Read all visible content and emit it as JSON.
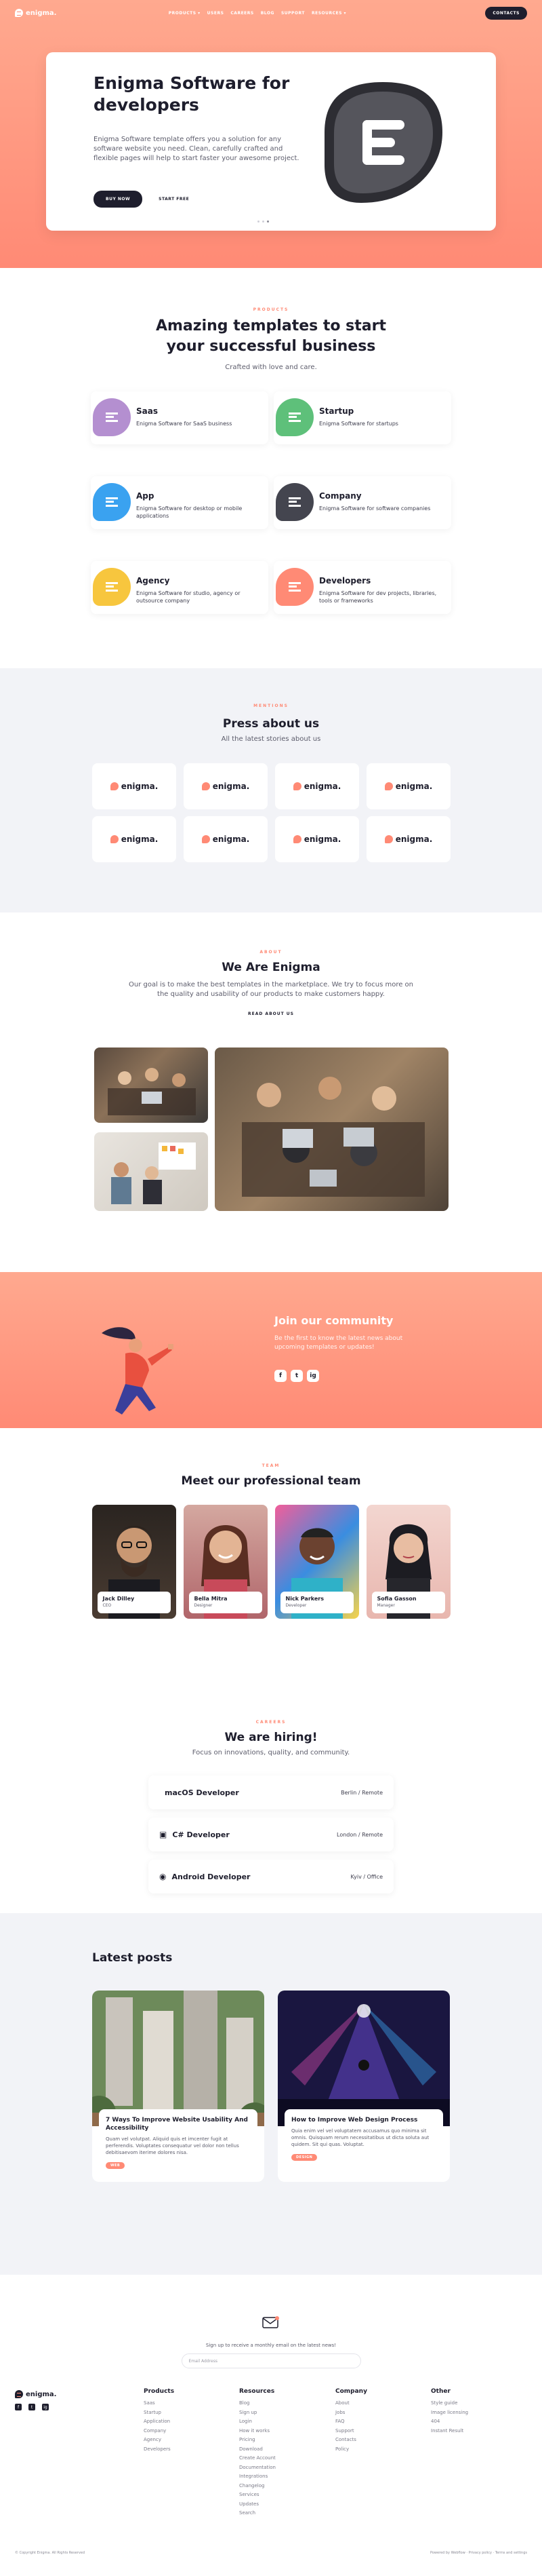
{
  "header": {
    "logo": "enigma.",
    "nav": [
      "PRODUCTS ▾",
      "USERS",
      "CAREERS",
      "BLOG",
      "SUPPORT",
      "RESOURCES ▾"
    ],
    "contact": "CONTACTS"
  },
  "hero": {
    "title": "Enigma Software for developers",
    "text": "Enigma Software template offers you a solution for any software website you need. Clean, carefully crafted and flexible pages will help to start faster your awesome project.",
    "buy": "BUY NOW",
    "free": "START FREE"
  },
  "templates": {
    "eyebrow": "PRODUCTS",
    "title": "Amazing templates to start your successful business",
    "subtitle": "Crafted with love and care.",
    "items": [
      {
        "name": "Saas",
        "desc": "Enigma Software for SaaS business",
        "color": "#b48fd0"
      },
      {
        "name": "Startup",
        "desc": "Enigma Software for startups",
        "color": "#5ec07a"
      },
      {
        "name": "App",
        "desc": "Enigma Software for desktop or mobile applications",
        "color": "#3aa2f0"
      },
      {
        "name": "Company",
        "desc": "Enigma Software for software companies",
        "color": "#44454f"
      },
      {
        "name": "Agency",
        "desc": "Enigma Software for studio, agency or outsource company",
        "color": "#f7c63e"
      },
      {
        "name": "Developers",
        "desc": "Enigma Software for dev projects, libraries, tools or frameworks",
        "color": "#ff8a75"
      }
    ]
  },
  "press": {
    "eyebrow": "MENTIONS",
    "title": "Press about us",
    "subtitle": "All the latest stories about us",
    "logo": "enigma."
  },
  "about": {
    "eyebrow": "ABOUT",
    "title": "We Are Enigma",
    "text": "Our goal is to make the best templates in the marketplace. We try to focus more on the quality and usability of our products to make customers happy.",
    "readmore": "READ ABOUT US"
  },
  "community": {
    "title": "Join our community",
    "text": "Be the first to know the latest news about upcoming templates or updates!",
    "icons": [
      "f",
      "t",
      "ig"
    ]
  },
  "team": {
    "eyebrow": "TEAM",
    "title": "Meet our professional team",
    "members": [
      {
        "name": "Jack Dilley",
        "role": "CEO"
      },
      {
        "name": "Bella Mitra",
        "role": "Designer"
      },
      {
        "name": "Nick Parkers",
        "role": "Developer"
      },
      {
        "name": "Sofia Gasson",
        "role": "Manager"
      }
    ]
  },
  "careers": {
    "eyebrow": "CAREERS",
    "title": "We are hiring!",
    "subtitle": "Focus on innovations, quality, and community.",
    "jobs": [
      {
        "title": "macOS Developer",
        "location": "Berlin / Remote",
        "icon": ""
      },
      {
        "title": "C# Developer",
        "location": "London / Remote",
        "icon": "▣"
      },
      {
        "title": "Android Developer",
        "location": "Kyiv / Office",
        "icon": "◉"
      }
    ]
  },
  "posts": {
    "title": "Latest posts",
    "items": [
      {
        "title": "7 Ways To Improve Website Usability And Accessibility",
        "text": "Quam vel volutpat. Aliquid quis et imcenter fugit at perferendis. Voluptates consequatur vel dolor non tellus debitisaevom iterime dolores nisa.",
        "tag": "WEB"
      },
      {
        "title": "How to Improve Web Design Process",
        "text": "Quia enim vel vel voluptatem accusamus quo minima sit omnis. Quisquam rerum necessitatibus ut dicta soluta aut quidem. Sit qui quas. Voluptat.",
        "tag": "DESIGN"
      }
    ]
  },
  "newsletter": {
    "text": "Sign up to receive a monthly email on the latest news!",
    "placeholder": "Email Address"
  },
  "footer": {
    "logo": "enigma.",
    "social": [
      "f",
      "t",
      "ig"
    ],
    "cols": [
      {
        "title": "Products",
        "items": [
          "Saas",
          "Startup",
          "Application",
          "Company",
          "Agency",
          "Developers"
        ]
      },
      {
        "title": "Resources",
        "items": [
          "Blog",
          "Sign up",
          "Login",
          "How it works",
          "Pricing",
          "Download",
          "Create Account",
          "Documentation",
          "Integrations",
          "Changelog",
          "Services",
          "Updates",
          "Search"
        ]
      },
      {
        "title": "Company",
        "items": [
          "About",
          "Jobs",
          "FAQ",
          "Support",
          "Contacts",
          "Policy"
        ]
      },
      {
        "title": "Other",
        "items": [
          "Style guide",
          "Image licensing",
          "404",
          "Instant Result"
        ]
      }
    ],
    "copyright": "© Copyright Enigma. All Rights Reserved",
    "powered": "Powered by Webflow · Privacy policy · Terms and settings"
  }
}
